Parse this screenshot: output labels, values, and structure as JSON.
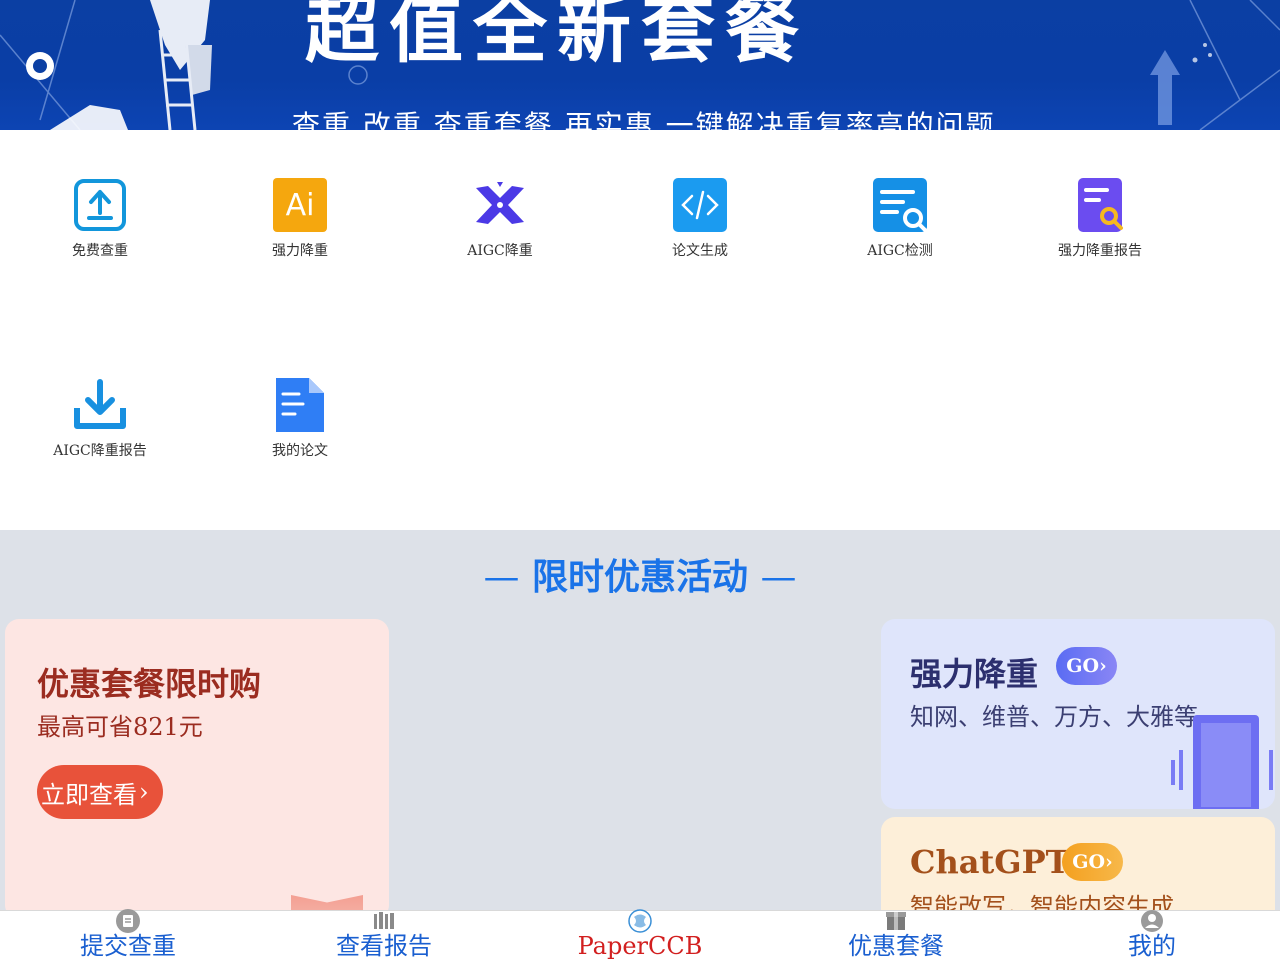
{
  "banner": {
    "title": "超值全新套餐",
    "subtitle": "查重 改重 查重套餐 再实惠 一键解决重复率高的问题"
  },
  "services": [
    {
      "label": "免费查重",
      "icon": "upload-icon",
      "color": "#1296db"
    },
    {
      "label": "强力降重",
      "icon": "ai-icon",
      "color": "#f5a70e"
    },
    {
      "label": "AIGC降重",
      "icon": "aigc-cross-icon",
      "color": "#4b39e6"
    },
    {
      "label": "论文生成",
      "icon": "code-icon",
      "color": "#1b9bf0"
    },
    {
      "label": "AIGC检测",
      "icon": "document-search-icon",
      "color": "#1590e6"
    },
    {
      "label": "强力降重报告",
      "icon": "report-search-icon",
      "color": "#6b4cf0"
    },
    {
      "label": "AIGC降重报告",
      "icon": "download-icon",
      "color": "#1890e0"
    },
    {
      "label": "我的论文",
      "icon": "document-icon",
      "color": "#2f7ef5"
    }
  ],
  "promo": {
    "heading": "限时优惠活动",
    "dash": "—",
    "left": {
      "title": "优惠套餐限时购",
      "subtitle": "最高可省821元",
      "button": "立即查看"
    },
    "right1": {
      "title": "强力降重",
      "go": "GO",
      "subtitle": "知网、维普、万方、大雅等"
    },
    "right2": {
      "title": "ChatGPT",
      "go": "GO",
      "subtitle": "智能改写，智能内容生成"
    }
  },
  "tabs": [
    {
      "label": "提交查重",
      "icon": "document-icon"
    },
    {
      "label": "查看报告",
      "icon": "books-icon"
    },
    {
      "label": "PaperCCB",
      "icon": "logo-icon"
    },
    {
      "label": "优惠套餐",
      "icon": "package-icon"
    },
    {
      "label": "我的",
      "icon": "user-icon"
    }
  ],
  "colors": {
    "brand_blue": "#1a73e8",
    "tab_active": "#d21f1f",
    "tab_inactive": "#1a5fd0",
    "promo_bg": "#dde1e8"
  }
}
